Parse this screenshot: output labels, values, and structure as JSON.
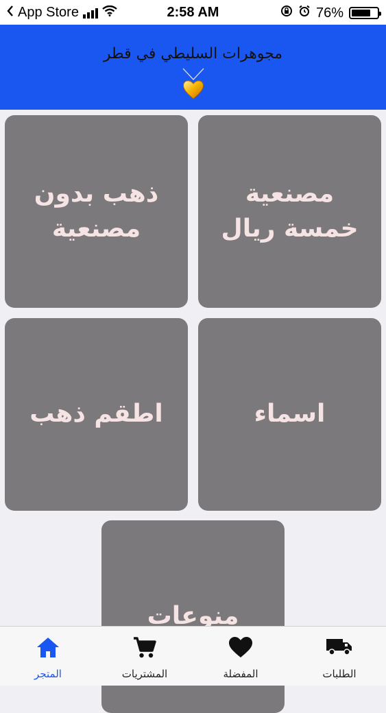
{
  "status_bar": {
    "back_app": "App Store",
    "time": "2:58 AM",
    "battery_percent": "76%",
    "battery_level": 0.76
  },
  "header": {
    "title": "مجوهرات السليطي في قطر",
    "logo_icon": "gold-heart-necklace-icon"
  },
  "tiles": [
    {
      "label": "مصنعية خمسة ريال"
    },
    {
      "label": "ذهب بدون مصنعية"
    },
    {
      "label": "اسماء"
    },
    {
      "label": "اطقم ذهب"
    },
    {
      "label": "منوعات"
    }
  ],
  "tab_bar": {
    "active": "store",
    "tabs": [
      {
        "id": "orders",
        "label": "الطلبات",
        "icon": "truck-icon"
      },
      {
        "id": "favorites",
        "label": "المفضلة",
        "icon": "heart-icon"
      },
      {
        "id": "purchases",
        "label": "المشتريات",
        "icon": "cart-icon"
      },
      {
        "id": "store",
        "label": "المتجر",
        "icon": "home-icon"
      }
    ]
  },
  "colors": {
    "header_bg": "#1a57f0",
    "tile_bg": "#7b797c",
    "tile_text": "#f6e3e3",
    "active_tab": "#1a57f0",
    "page_bg": "#efeff4"
  }
}
